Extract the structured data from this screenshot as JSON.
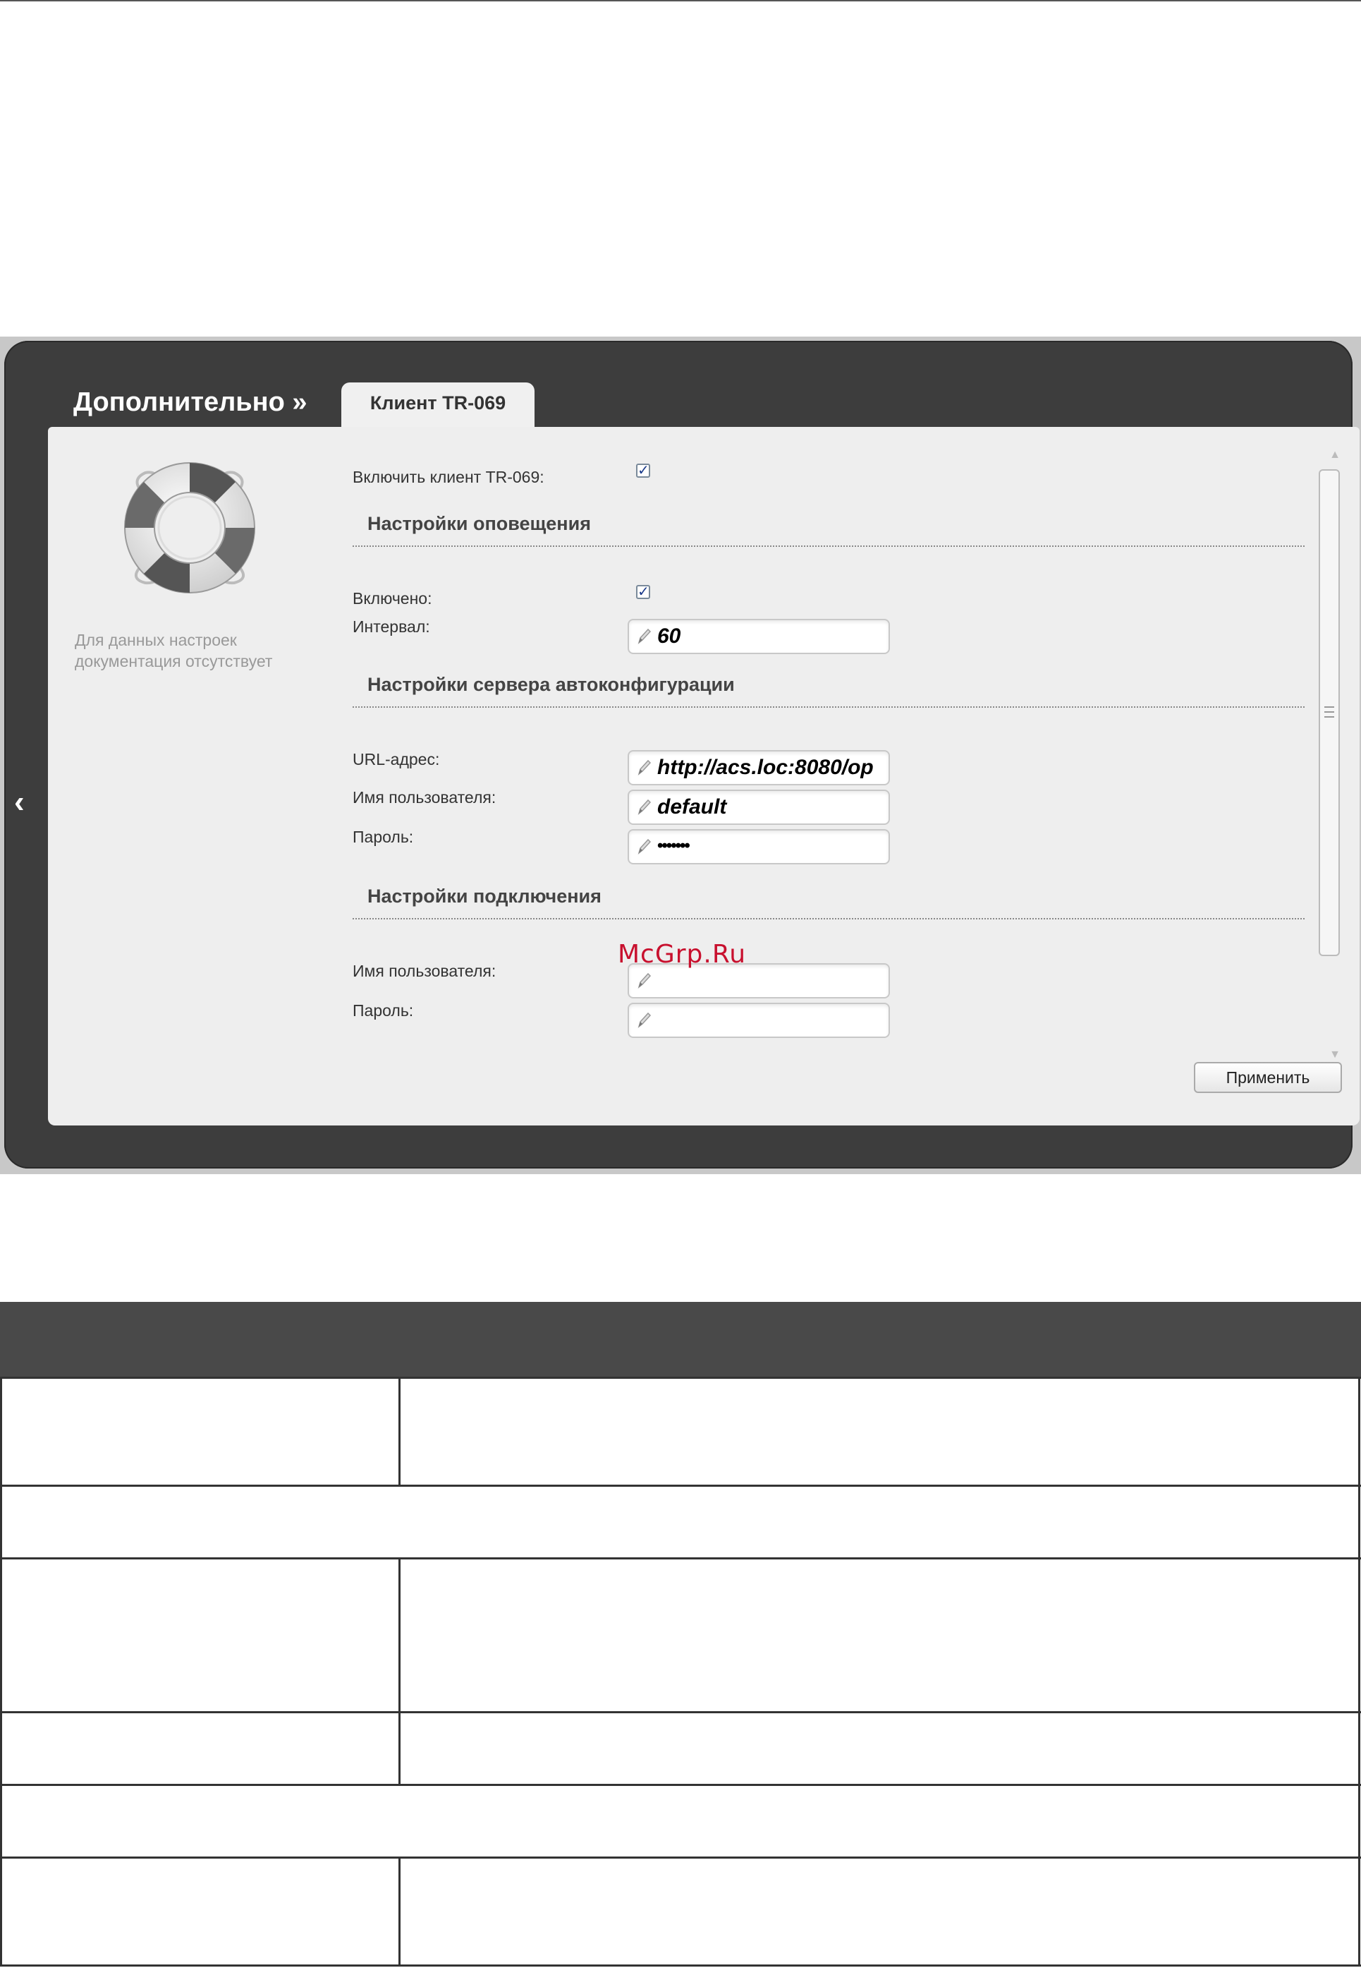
{
  "header": {
    "section_title": "Дополнительно »",
    "active_tab": "Клиент TR-069"
  },
  "sidebar": {
    "help_text_line1": "Для данных настроек",
    "help_text_line2": "документация отсутствует"
  },
  "form": {
    "enable_client": {
      "label": "Включить клиент TR-069:",
      "checked": true
    },
    "notification_settings": {
      "header": "Настройки оповещения",
      "enabled_label": "Включено:",
      "enabled_checked": true,
      "interval_label": "Интервал:",
      "interval_value": "60"
    },
    "acs_settings": {
      "header": "Настройки сервера автоконфигурации",
      "url_label": "URL-адрес:",
      "url_value": "http://acs.loc:8080/op",
      "username_label": "Имя пользователя:",
      "username_value": "default",
      "password_label": "Пароль:",
      "password_value": "•••••••"
    },
    "connection_settings": {
      "header": "Настройки подключения",
      "username_label": "Имя пользователя:",
      "username_value": "",
      "password_label": "Пароль:",
      "password_value": ""
    },
    "apply_label": "Применить"
  },
  "watermark": "McGrp.Ru",
  "icons": {
    "back": "chevron-left-icon",
    "help": "lifebuoy-icon",
    "edit": "pencil-icon",
    "check": "checkmark-icon"
  },
  "colors": {
    "frame_dark": "#3d3d3d",
    "panel": "#eeeeee",
    "table_header": "#494949",
    "watermark": "#c8102e"
  }
}
